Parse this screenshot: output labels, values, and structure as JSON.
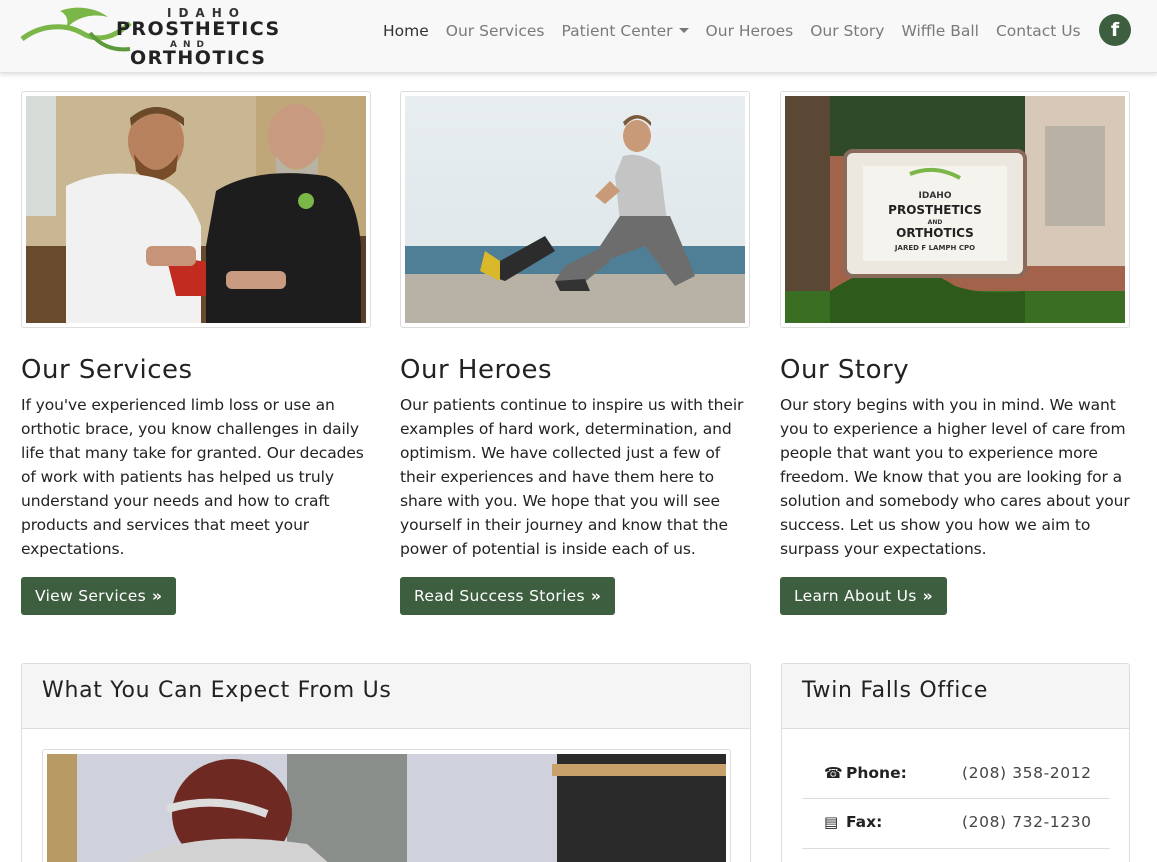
{
  "brand": {
    "line1": "IDAHO",
    "line2": "PROSTHETICS",
    "line3": "AND",
    "line4": "ORTHOTICS",
    "accent_color": "#7ab648"
  },
  "nav": {
    "items": [
      "Home",
      "Our Services",
      "Patient Center",
      "Our Heroes",
      "Our Story",
      "Wiffle Ball",
      "Contact Us"
    ],
    "active": "Home",
    "facebook_icon": "f"
  },
  "cards": [
    {
      "title": "Our Services",
      "text": "If you've experienced limb loss or use an orthotic brace, you know challenges in daily life that many take for granted. Our decades of work with patients has helped us truly understand your needs and how to craft products and services that meet your expectations.",
      "button": "View Services"
    },
    {
      "title": "Our Heroes",
      "text": "Our patients continue to inspire us with their examples of hard work, determination, and optimism. We have collected just a few of their experiences and have them here to share with you. We hope that you will see yourself in their journey and know that the power of potential is inside each of us.",
      "button": "Read Success Stories"
    },
    {
      "title": "Our Story",
      "text": "Our story begins with you in mind. We want you to experience a higher level of care from people that want you to experience more freedom. We know that you are looking for a solution and somebody who cares about your success. Let us show you how we aim to surpass your expectations.",
      "button": "Learn About Us"
    }
  ],
  "sign": {
    "line1": "IDAHO",
    "line2": "PROSTHETICS",
    "line3": "AND",
    "line4": "ORTHOTICS",
    "line5": "JARED F LAMPH CPO"
  },
  "expect_panel": {
    "title": "What You Can Expect From Us"
  },
  "office_panel": {
    "title": "Twin Falls Office",
    "phone_label": "Phone:",
    "phone": "(208) 358-2012",
    "fax_label": "Fax:",
    "fax": "(208) 732-1230"
  },
  "colors": {
    "primary_button": "#3e5e40",
    "navbar_bg": "#f8f8f8"
  }
}
